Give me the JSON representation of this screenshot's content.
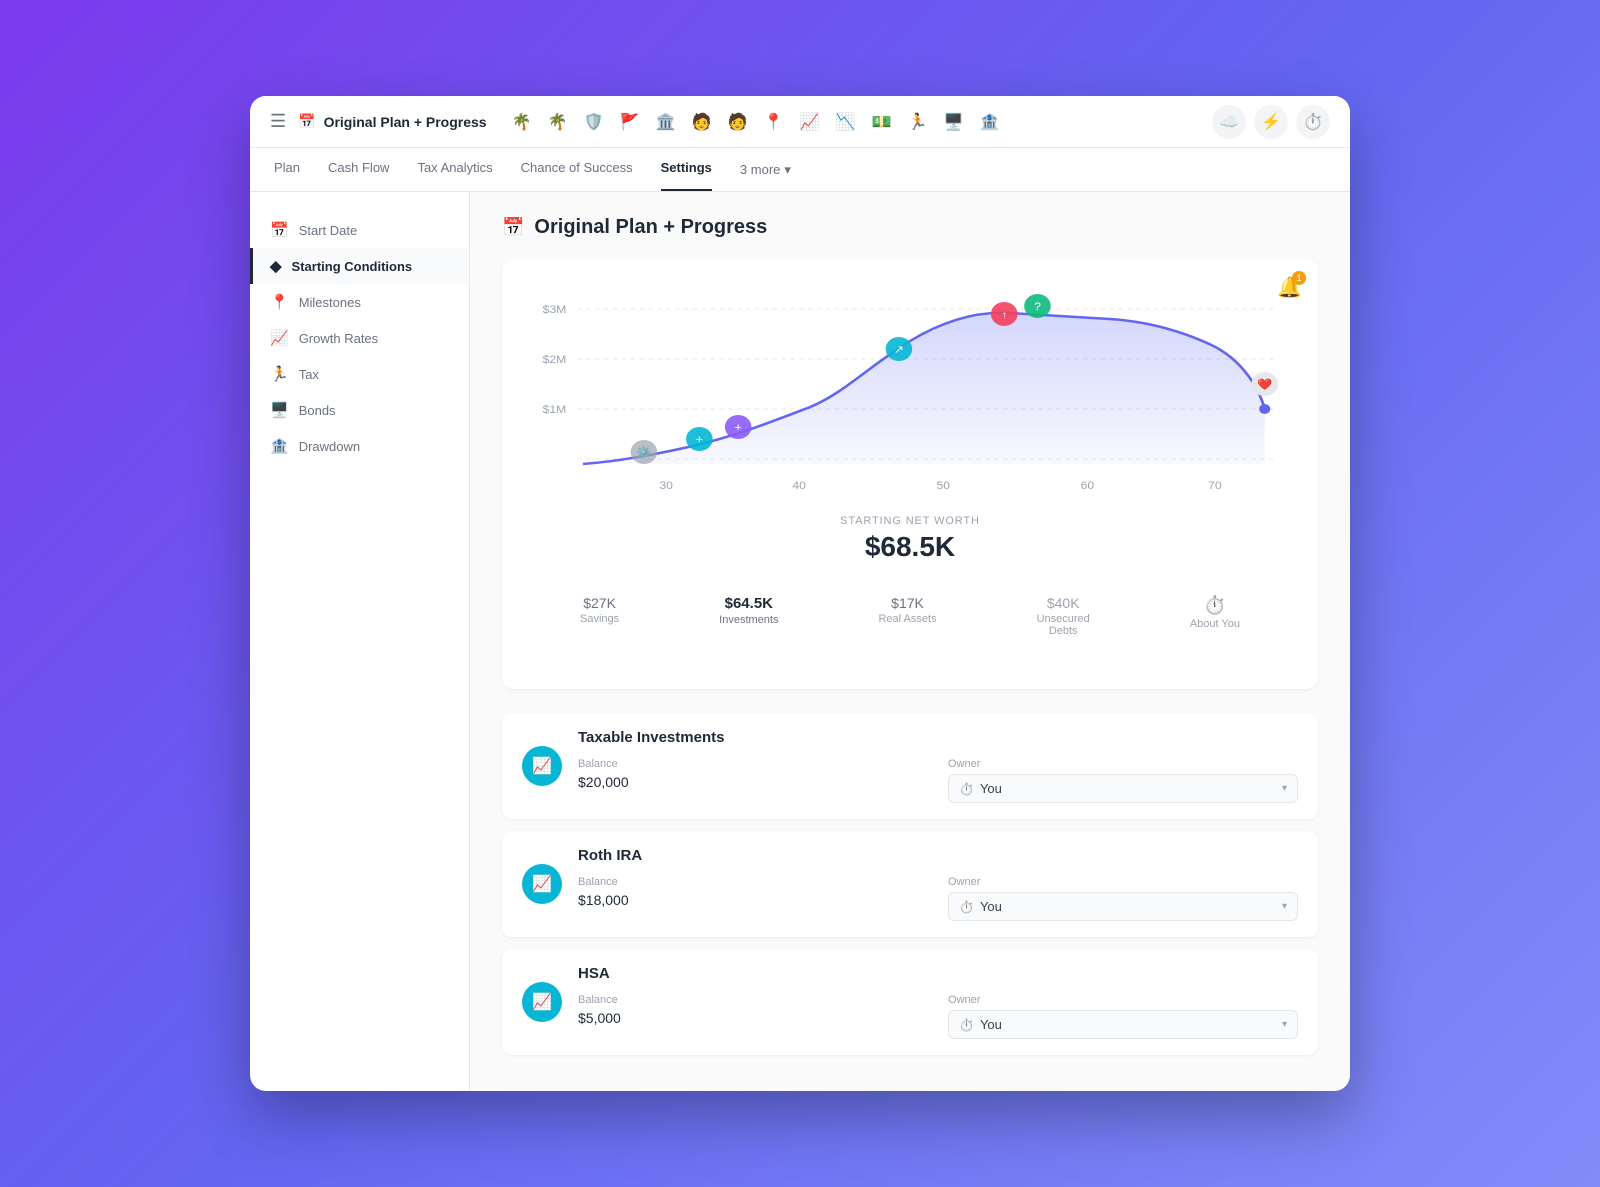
{
  "app": {
    "title": "Original Plan + Progress",
    "window_icon": "📅"
  },
  "header": {
    "hamburger": "≡",
    "icons": [
      {
        "name": "palm-tree-green",
        "symbol": "🌴",
        "color": "#10b981"
      },
      {
        "name": "palm-tree-pink",
        "symbol": "🌴",
        "color": "#f43f5e"
      },
      {
        "name": "heart-shield",
        "symbol": "🛡️"
      },
      {
        "name": "flag",
        "symbol": "🚩",
        "color": "#10b981"
      },
      {
        "name": "building",
        "symbol": "🏛️"
      },
      {
        "name": "person-teal",
        "symbol": "🧑",
        "color": "#06b6d4"
      },
      {
        "name": "person-purple",
        "symbol": "🧑",
        "color": "#8b5cf6"
      },
      {
        "name": "pin",
        "symbol": "📍",
        "color": "#f59e0b"
      },
      {
        "name": "chart-up",
        "symbol": "📈",
        "color": "#10b981"
      },
      {
        "name": "chart-down",
        "symbol": "📉",
        "color": "#10b981"
      },
      {
        "name": "dollar",
        "symbol": "💵",
        "color": "#f59e0b"
      },
      {
        "name": "person-run",
        "symbol": "🏃",
        "color": "#f43f5e"
      },
      {
        "name": "screen",
        "symbol": "🖥️",
        "color": "#6b7280"
      },
      {
        "name": "bank",
        "symbol": "🏦",
        "color": "#6b7280"
      }
    ],
    "right_icons": [
      {
        "name": "cloud",
        "symbol": "☁️"
      },
      {
        "name": "lightning",
        "symbol": "⚡"
      },
      {
        "name": "clock",
        "symbol": "⏱️"
      }
    ]
  },
  "tabs": [
    {
      "label": "Plan",
      "active": false
    },
    {
      "label": "Cash Flow",
      "active": false
    },
    {
      "label": "Tax Analytics",
      "active": false
    },
    {
      "label": "Chance of Success",
      "active": false
    },
    {
      "label": "Settings",
      "active": true
    },
    {
      "label": "3 more",
      "active": false,
      "has_dropdown": true
    }
  ],
  "sidebar": {
    "items": [
      {
        "label": "Start Date",
        "icon": "📅",
        "active": false
      },
      {
        "label": "Starting Conditions",
        "icon": "◆",
        "active": true
      },
      {
        "label": "Milestones",
        "icon": "📍",
        "active": false
      },
      {
        "label": "Growth Rates",
        "icon": "📈",
        "active": false
      },
      {
        "label": "Tax",
        "icon": "🏃",
        "active": false
      },
      {
        "label": "Bonds",
        "icon": "🖥️",
        "active": false
      },
      {
        "label": "Drawdown",
        "icon": "🏦",
        "active": false
      }
    ]
  },
  "content": {
    "title": "Original Plan + Progress",
    "chart": {
      "y_labels": [
        "$3M",
        "$2M",
        "$1M"
      ],
      "x_labels": [
        "30",
        "40",
        "50",
        "60",
        "70"
      ],
      "notification_count": "1"
    },
    "net_worth": {
      "label": "STARTING NET WORTH",
      "value": "$68.5K"
    },
    "category_tabs": [
      {
        "amount": "$27K",
        "label": "Savings",
        "selected": false
      },
      {
        "amount": "$64.5K",
        "label": "Investments",
        "selected": true
      },
      {
        "amount": "$17K",
        "label": "Real Assets",
        "selected": false
      },
      {
        "amount": "$40K",
        "label": "Unsecured Debts",
        "selected": false
      },
      {
        "amount": "⏱️",
        "label": "About You",
        "selected": false
      }
    ],
    "investments_section_title": "Taxable Investments",
    "investment_items": [
      {
        "name": "Taxable Investments",
        "icon": "📈",
        "balance_label": "Balance",
        "balance_value": "$20,000",
        "owner_label": "Owner",
        "owner_value": "You",
        "owner_icon": "⏱️"
      },
      {
        "name": "Roth IRA",
        "icon": "📈",
        "balance_label": "Balance",
        "balance_value": "$18,000",
        "owner_label": "Owner",
        "owner_value": "You",
        "owner_icon": "⏱️"
      },
      {
        "name": "HSA",
        "icon": "📈",
        "balance_label": "Balance",
        "balance_value": "$5,000",
        "owner_label": "Owner",
        "owner_value": "You",
        "owner_icon": "⏱️"
      }
    ]
  }
}
